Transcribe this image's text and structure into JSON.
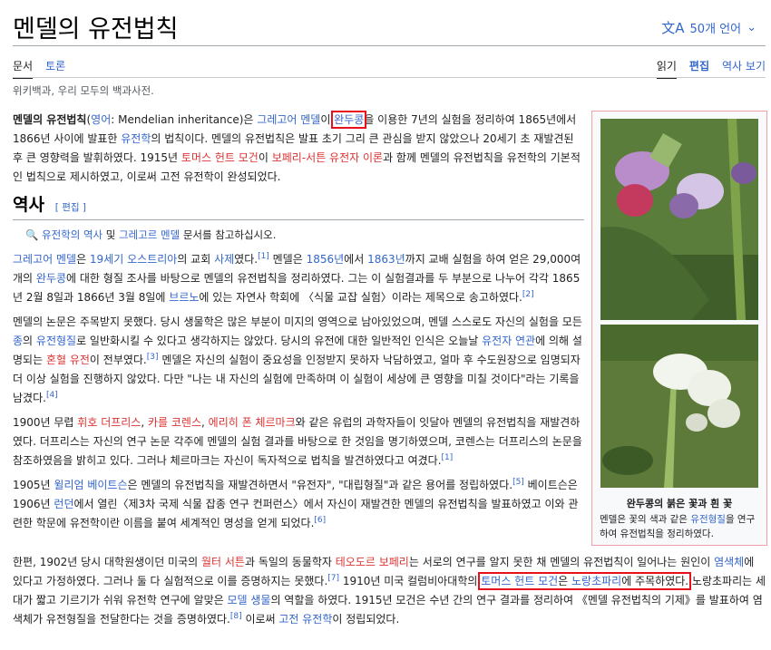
{
  "title": "멘델의 유전법칙",
  "lang_button": "50개 언어",
  "tabs": {
    "article": "문서",
    "talk": "토론",
    "read": "읽기",
    "edit": "편집",
    "history": "역사 보기"
  },
  "tagline": "위키백과, 우리 모두의 백과사전.",
  "section_heading": "역사",
  "section_edit": "[ 편집 ]",
  "infobox": {
    "caption_title": "완두콩의 붉은 꽃과 흰 꽃",
    "caption_pre": "멘델은 꽃의 색과 같은 ",
    "caption_link": "유전형질",
    "caption_post": "을 연구하여 유전법칙을 정리하였다."
  },
  "colors": {
    "link": "#3366cc",
    "redlink": "#dd3333",
    "highlight_box": "#e8101a"
  }
}
